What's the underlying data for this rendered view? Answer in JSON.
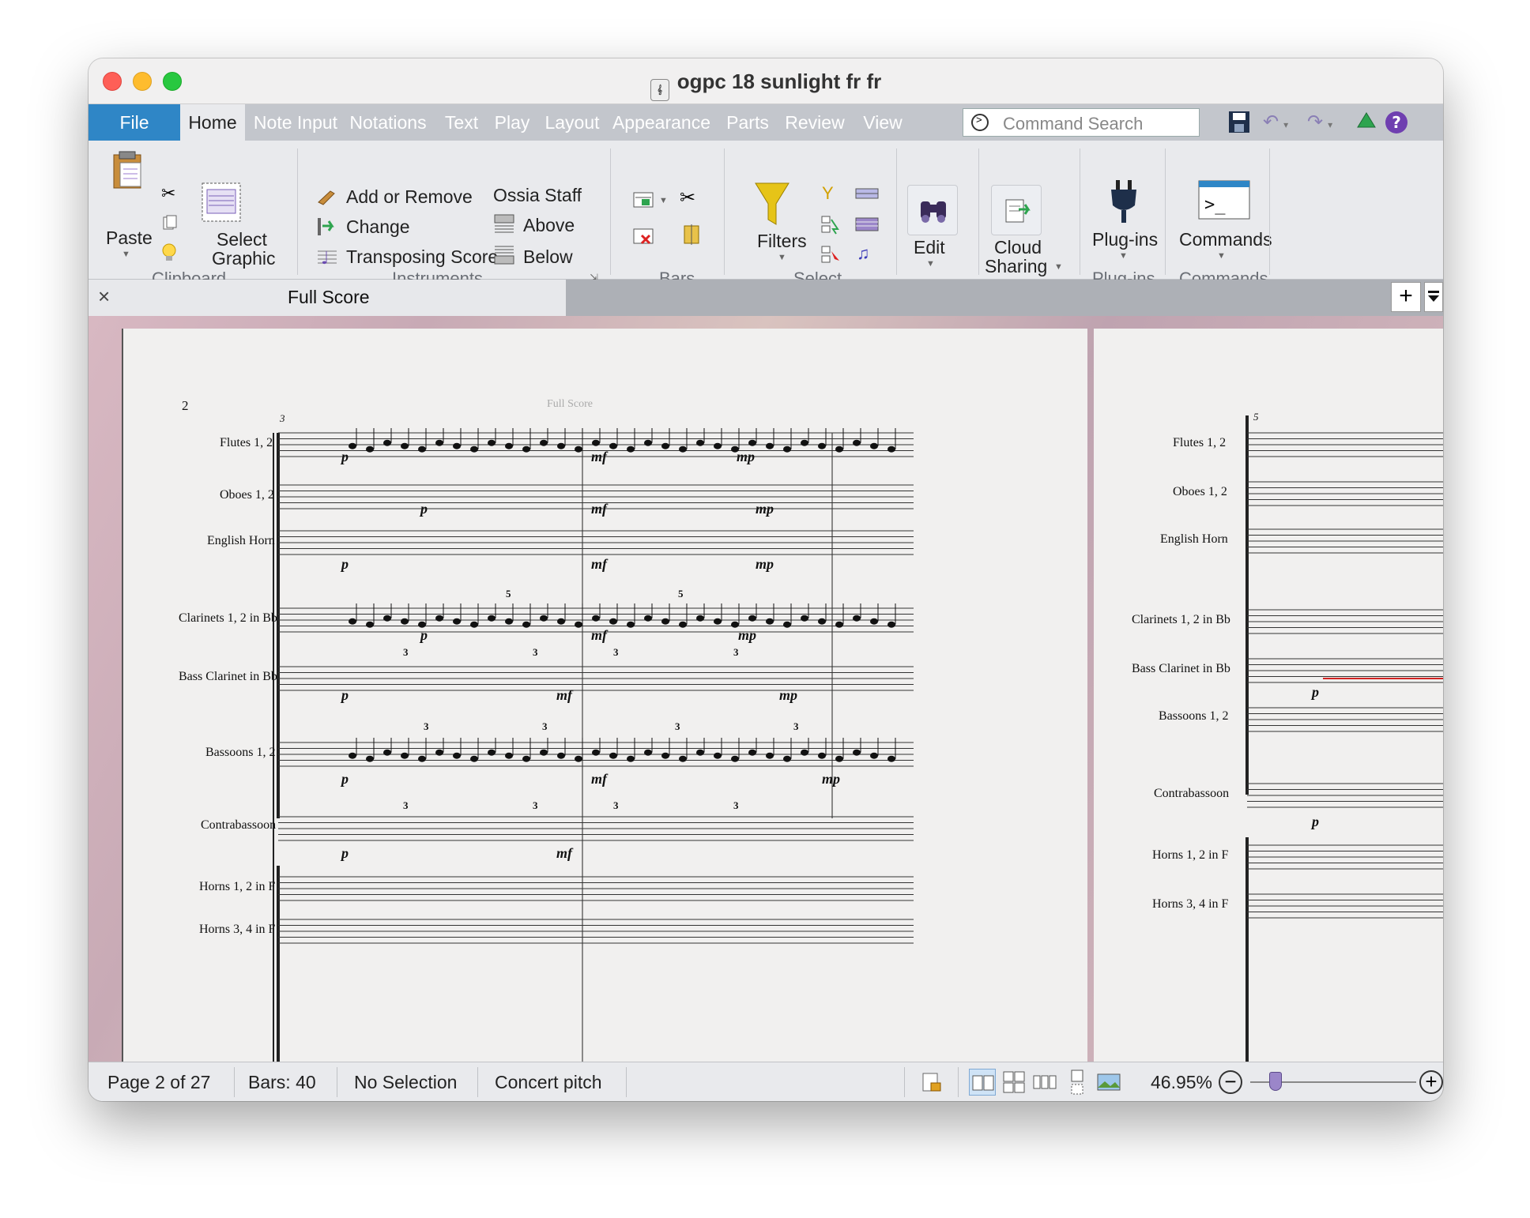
{
  "window": {
    "title": "ogpc 18 sunlight fr fr"
  },
  "tabs": {
    "file": "File",
    "items": [
      "Home",
      "Note Input",
      "Notations",
      "Text",
      "Play",
      "Layout",
      "Appearance",
      "Parts",
      "Review",
      "View"
    ]
  },
  "search": {
    "placeholder": "Command Search"
  },
  "ribbon": {
    "paste": "Paste",
    "select_graphic_1": "Select",
    "select_graphic_2": "Graphic",
    "clipboard_group": "Clipboard",
    "add_or_remove": "Add or Remove",
    "change": "Change",
    "transposing_score": "Transposing Score",
    "ossia_staff": "Ossia Staff",
    "above": "Above",
    "below": "Below",
    "instruments_group": "Instruments",
    "bars_group": "Bars",
    "filters": "Filters",
    "select_group": "Select",
    "edit": "Edit",
    "cloud_1": "Cloud",
    "cloud_2": "Sharing",
    "plugins": "Plug-ins",
    "plugins_group": "Plug-ins",
    "commands": "Commands",
    "commands_group": "Commands"
  },
  "document_tab": {
    "label": "Full Score"
  },
  "score": {
    "page_number": "2",
    "header": "Full Score",
    "bar_3": "3",
    "bar_5": "5",
    "tuplet_3": "3",
    "tuplet_5": "5",
    "instruments": [
      "Flutes 1, 2",
      "Oboes 1, 2",
      "English Horn",
      "Clarinets 1, 2 in Bb",
      "Bass Clarinet in Bb",
      "Bassoons 1, 2",
      "Contrabassoon",
      "Horns 1, 2 in F",
      "Horns 3, 4 in F"
    ],
    "dynamics": {
      "p": "p",
      "mf": "mf",
      "mp": "mp"
    }
  },
  "status": {
    "page": "Page 2 of 27",
    "bars": "Bars: 40",
    "selection": "No Selection",
    "pitch": "Concert pitch",
    "zoom": "46.95%"
  },
  "colors": {
    "file_tab": "#2f86c6",
    "ribbon_bg": "#e9eaed",
    "tabbar_bg": "#c3c6cc",
    "selection_red": "#d22222"
  }
}
